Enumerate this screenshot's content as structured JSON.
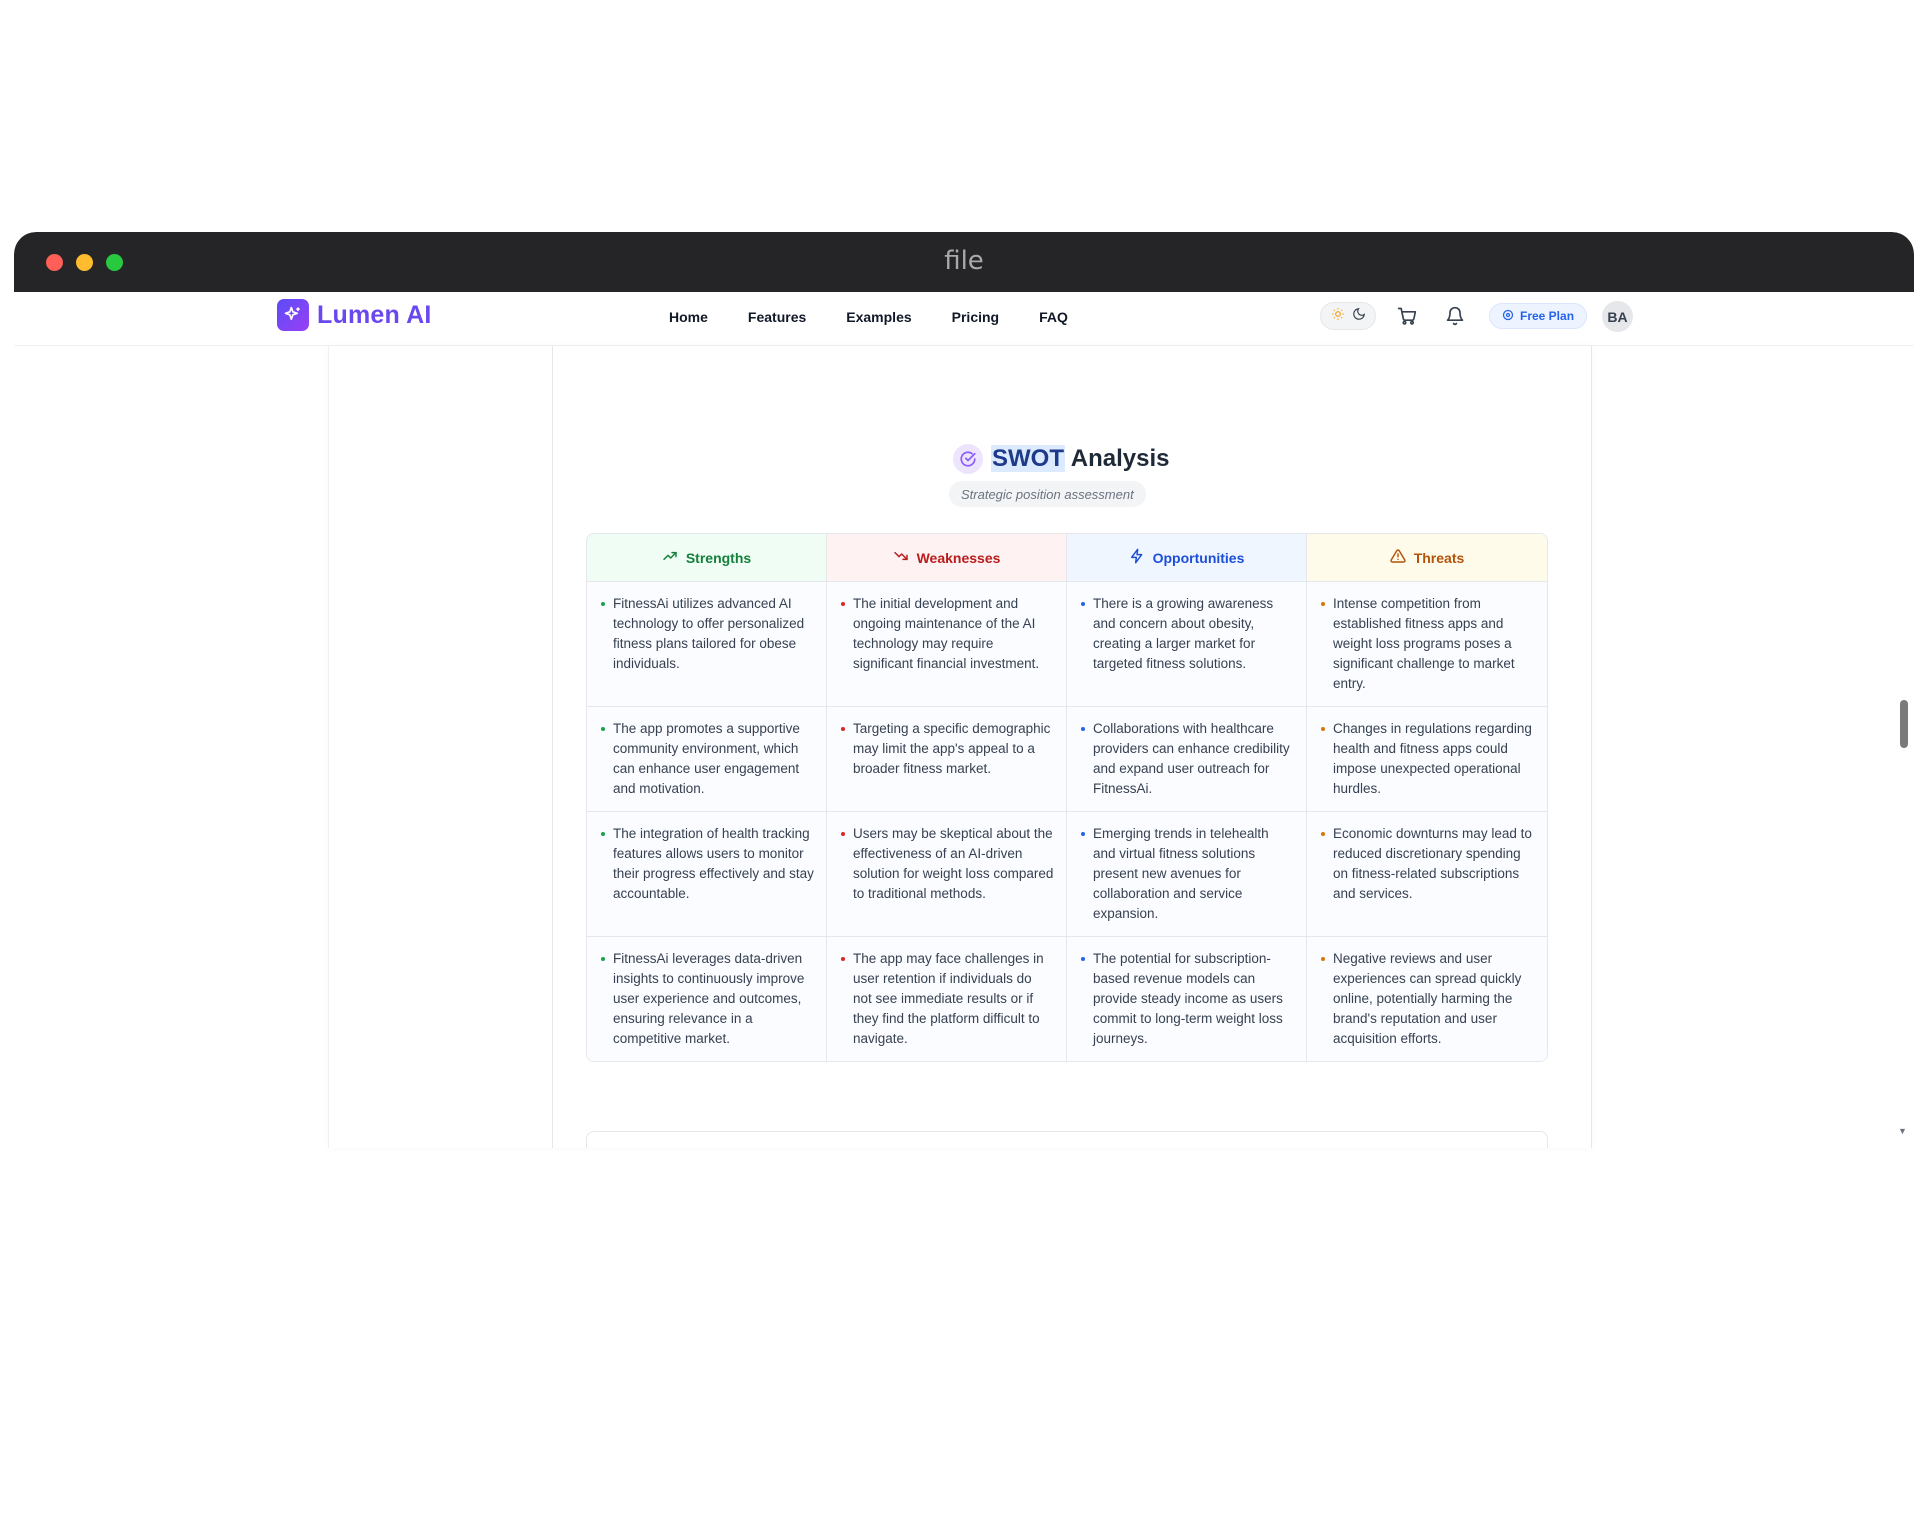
{
  "window": {
    "title": "file"
  },
  "navbar": {
    "brand": "Lumen AI",
    "links": [
      "Home",
      "Features",
      "Examples",
      "Pricing",
      "FAQ"
    ],
    "plan_badge": "Free Plan",
    "avatar_initials": "BA"
  },
  "swot": {
    "title_highlight": "SWOT",
    "title_rest": "Analysis",
    "subtitle": "Strategic position assessment",
    "headers": {
      "strengths": "Strengths",
      "weaknesses": "Weaknesses",
      "opportunities": "Opportunities",
      "threats": "Threats"
    },
    "rows": [
      {
        "s": "FitnessAi utilizes advanced AI technology to offer personalized fitness plans tailored for obese individuals.",
        "w": "The initial development and ongoing maintenance of the AI technology may require significant financial investment.",
        "o": "There is a growing awareness and concern about obesity, creating a larger market for targeted fitness solutions.",
        "t": "Intense competition from established fitness apps and weight loss programs poses a significant challenge to market entry."
      },
      {
        "s": "The app promotes a supportive community environment, which can enhance user engagement and motivation.",
        "w": "Targeting a specific demographic may limit the app's appeal to a broader fitness market.",
        "o": "Collaborations with healthcare providers can enhance credibility and expand user outreach for FitnessAi.",
        "t": "Changes in regulations regarding health and fitness apps could impose unexpected operational hurdles."
      },
      {
        "s": "The integration of health tracking features allows users to monitor their progress effectively and stay accountable.",
        "w": "Users may be skeptical about the effectiveness of an AI-driven solution for weight loss compared to traditional methods.",
        "o": "Emerging trends in telehealth and virtual fitness solutions present new avenues for collaboration and service expansion.",
        "t": "Economic downturns may lead to reduced discretionary spending on fitness-related subscriptions and services."
      },
      {
        "s": "FitnessAi leverages data-driven insights to continuously improve user experience and outcomes, ensuring relevance in a competitive market.",
        "w": "The app may face challenges in user retention if individuals do not see immediate results or if they find the platform difficult to navigate.",
        "o": "The potential for subscription-based revenue models can provide steady income as users commit to long-term weight loss journeys.",
        "t": "Negative reviews and user experiences can spread quickly online, potentially harming the brand's reputation and user acquisition efforts."
      }
    ]
  },
  "colors": {
    "brand": "#6a48f0",
    "strengths": "#15803d",
    "weaknesses": "#b91c1c",
    "opportunities": "#1d4ed8",
    "threats": "#b45309"
  }
}
